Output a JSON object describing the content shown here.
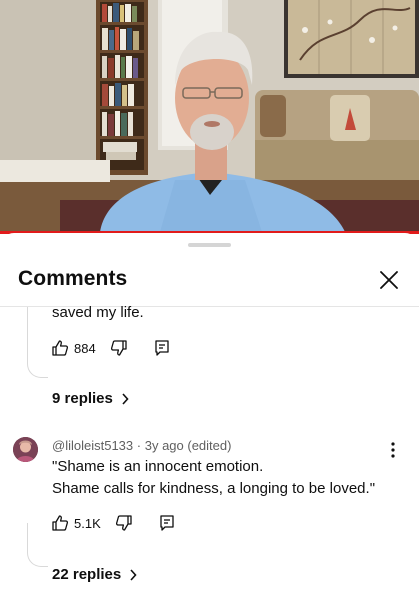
{
  "video": {
    "progress_fraction": 1.0,
    "progress_color": "#e21b1b"
  },
  "sheet": {
    "title": "Comments",
    "close_icon": "close-icon"
  },
  "comments": [
    {
      "text_lines": [
        "saved my life."
      ],
      "likes": "884",
      "replies_label": "9 replies"
    },
    {
      "author": "@liloleist5133",
      "separator": "·",
      "time": "3y ago (edited)",
      "text_lines": [
        "\"Shame is an innocent emotion.",
        "Shame calls for kindness, a longing to be loved.\""
      ],
      "likes": "5.1K",
      "replies_label": "22 replies"
    }
  ],
  "icons": {
    "like": "thumbs-up-icon",
    "dislike": "thumbs-down-icon",
    "reply": "reply-icon",
    "more": "more-vertical-icon",
    "chevron": "chevron-right-icon"
  }
}
